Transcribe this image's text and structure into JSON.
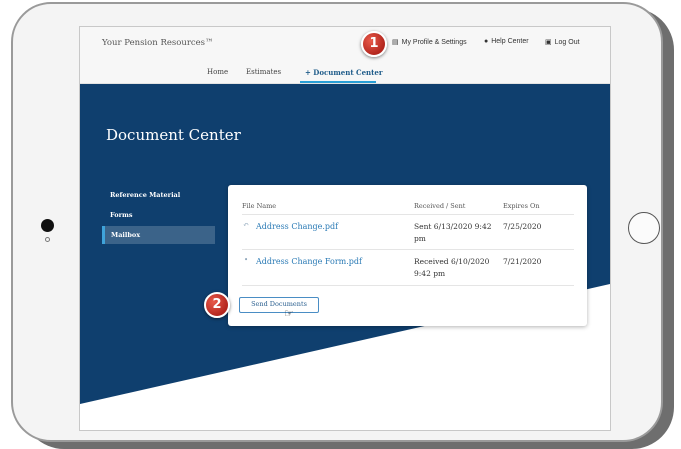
{
  "site": {
    "brand": "Your Pension Resources™",
    "utility_links": [
      {
        "label": "My Profile & Settings",
        "icon": "id-card-icon"
      },
      {
        "label": "Help Center",
        "icon": "question-circle-icon"
      },
      {
        "label": "Log Out",
        "icon": "lock-icon"
      }
    ]
  },
  "nav": {
    "items": [
      "Home",
      "Estimates",
      "+ Document Center"
    ],
    "active_index": 2
  },
  "page": {
    "title": "Document Center"
  },
  "sidebar": {
    "items": [
      "Reference Material",
      "Forms",
      "Mailbox"
    ],
    "active_index": 2
  },
  "documents": {
    "columns": [
      "File Name",
      "Received / Sent",
      "Expires On"
    ],
    "rows": [
      {
        "icon": "reply-arrow-icon",
        "file": "Address Change.pdf",
        "date_line1": "Sent 6/13/2020 9:42",
        "date_line2": "pm",
        "expires": "7/25/2020"
      },
      {
        "icon": "bullet-dot-icon",
        "file": "Address Change Form.pdf",
        "date_line1": "Received 6/10/2020",
        "date_line2": "9:42 pm",
        "expires": "7/21/2020"
      }
    ],
    "send_button": "Send Documents"
  },
  "callouts": [
    "1",
    "2"
  ],
  "colors": {
    "hero": "#0f3f6e",
    "accent": "#2a9fd6",
    "link": "#2a7ab5",
    "badge": "#c0392b"
  }
}
